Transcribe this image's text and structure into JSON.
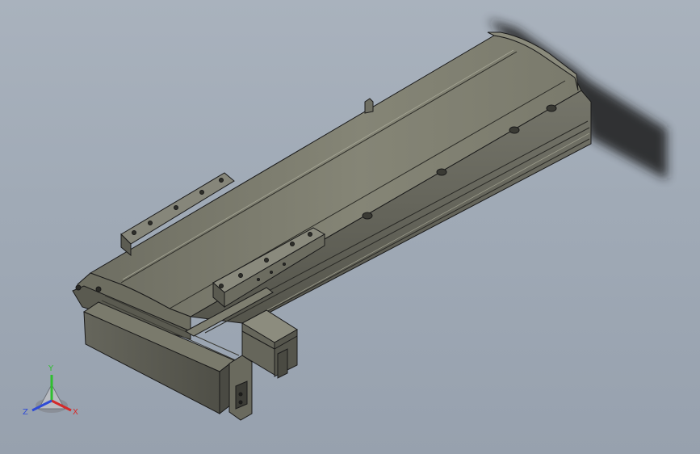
{
  "triad": {
    "labels": {
      "y": "Y",
      "x": "X",
      "z": "Z"
    },
    "colors": {
      "y": "#2fbf2f",
      "x": "#d42a2a",
      "z": "#2f4bd6"
    }
  },
  "colors": {
    "background_top": "#a9b2bd",
    "background_bottom": "#97a1ae",
    "housing_top": "#7c7c6e",
    "housing_side": "#5f5f54",
    "housing_edge": "#1a1a1a",
    "shadow": "#222222"
  }
}
